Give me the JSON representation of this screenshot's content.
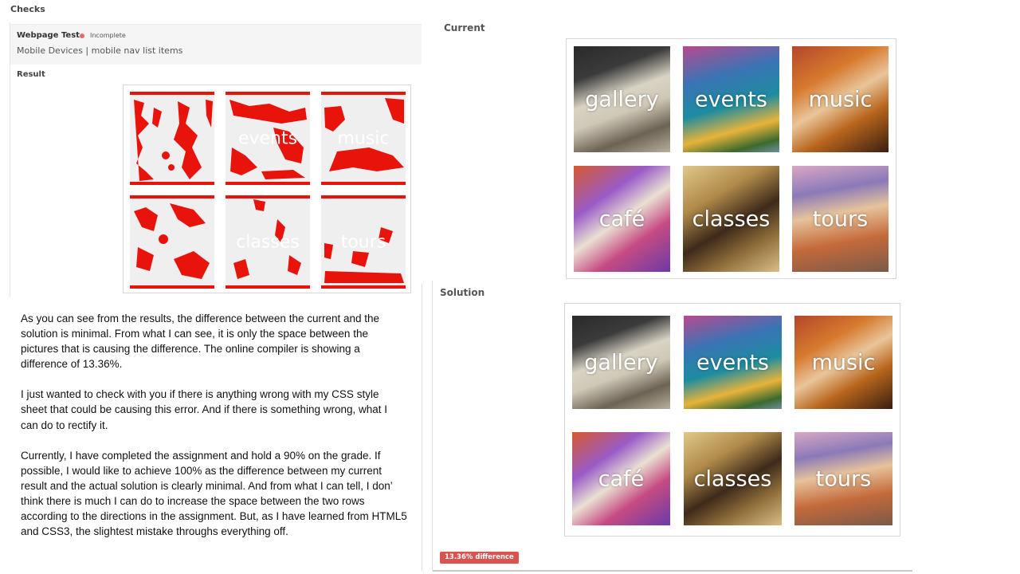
{
  "checks": {
    "title": "Checks",
    "test_name": "Webpage Test",
    "status": "Incomplete",
    "subtitle": "Mobile Devices | mobile nav list items",
    "result_label": "Result"
  },
  "panels": {
    "current_label": "Current",
    "solution_label": "Solution"
  },
  "tiles": [
    {
      "label": "gallery",
      "icon": "gallery-image"
    },
    {
      "label": "events",
      "icon": "events-image"
    },
    {
      "label": "music",
      "icon": "music-image"
    },
    {
      "label": "café",
      "icon": "cafe-image"
    },
    {
      "label": "classes",
      "icon": "classes-image"
    },
    {
      "label": "tours",
      "icon": "tours-image"
    }
  ],
  "description": {
    "p1": "As you can see from the results, the difference between the current and the solution is minimal.  From what I can see, it is only the space between the pictures that is causing the difference.  The online compiler is showing a difference of 13.36%.",
    "p2": "I just wanted to check with you if there is anything wrong with my CSS style sheet that could be causing this error. And if there is something wrong, what I can do to rectify it.",
    "p3": "Currently, I have completed the assignment and hold a 90% on the grade. If possible, I would like to achieve 100% as the difference between my current result and the actual solution is clearly minimal.  And from what I can tell, I don’ think there is much I can do to increase the space between the two rows according to the directions in the assignment.  But, as I have learned from HTML5 and CSS3, the slightest mistake throughs everything off."
  },
  "difference_badge": "13.36% difference",
  "colors": {
    "status_dot": "#e86b6b",
    "badge": "#d9534f",
    "diff_highlight": "#e8140c"
  }
}
